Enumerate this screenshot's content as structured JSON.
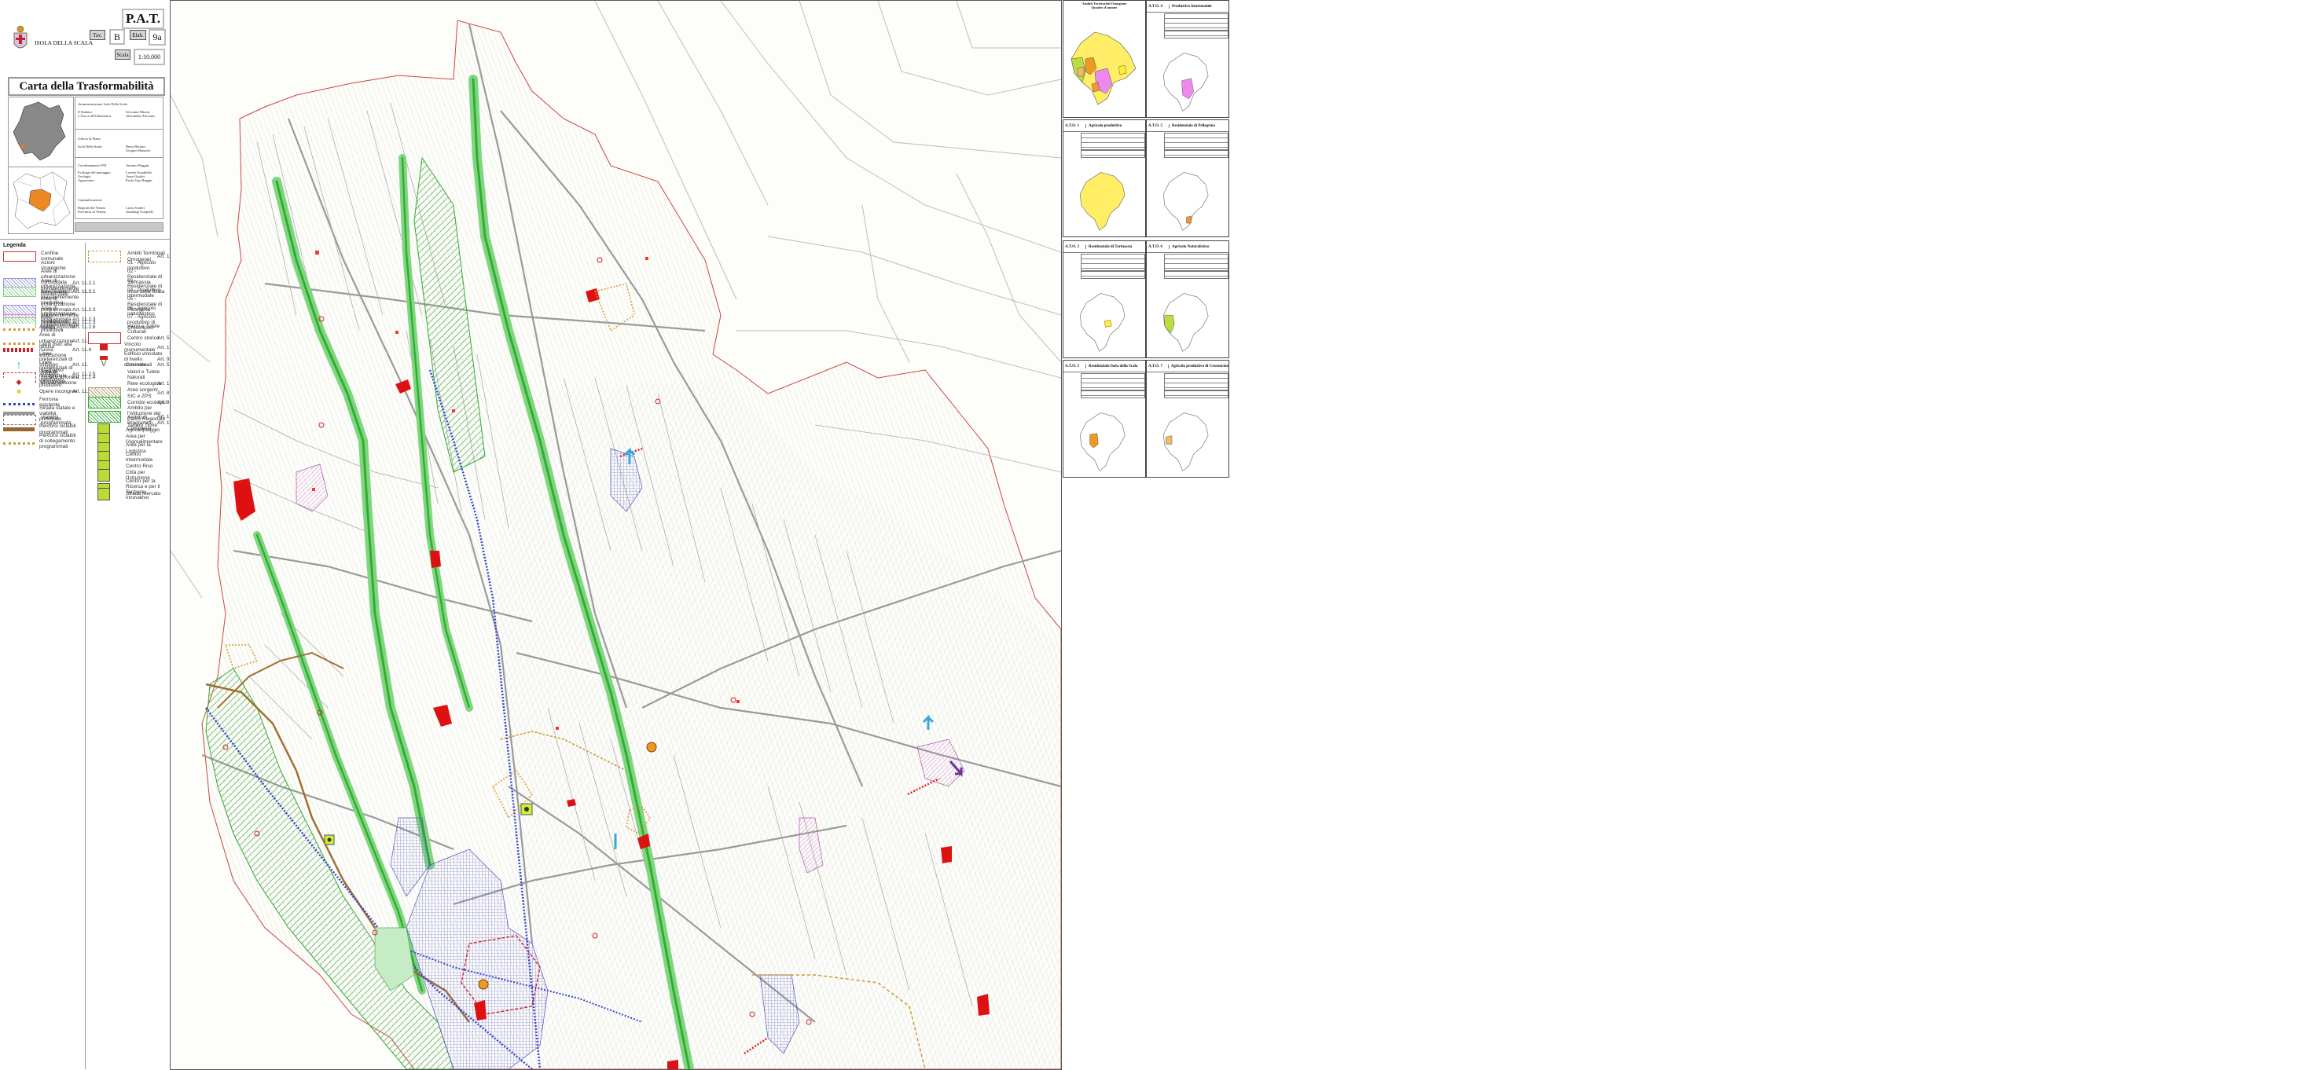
{
  "header": {
    "plan_code": "P.A.T.",
    "municipality": "ISOLA DELLA SCALA",
    "tav_label": "Tav.",
    "tav_value": "B",
    "elab_label": "Elab.",
    "elab_value": "9a",
    "scala_label": "Scala",
    "scala_value": "1:10.000",
    "title": "Carta della Trasformabilità"
  },
  "credits": [
    {
      "role": "Amministrazione Isola Della Scala",
      "names": ""
    },
    {
      "role": "Il Sindaco\nL'Ass.re all'Urbanistica",
      "names": "Giovanni Miozzi\nAlessandro Facciani"
    },
    {
      "role": "Ufficio di Piano",
      "names": ""
    },
    {
      "role": "Isola Della Scala",
      "names": "Berto Bertaso\nGiorgio Monachi"
    },
    {
      "role": "Coordinamento PAT",
      "names": "Antonio Buggin"
    },
    {
      "role": "Ecologia del paesaggio\nGeologia\nAgronomia",
      "names": "Loredo Scarabello\nAnna Giudici\nPaolo Ugo Buggin"
    },
    {
      "role": "Copianificazione",
      "names": ""
    },
    {
      "role": "Regione del Veneto\nProvincia di Verona",
      "names": "Lucia Scaleri\nGianluigi Scarpelly"
    }
  ],
  "legend": {
    "title": "Legenda",
    "left": [
      {
        "label": "Confine comunale",
        "art": "",
        "color": "#cc3333",
        "style": "outline"
      },
      {
        "label": "Azioni strategiche",
        "art": "",
        "color": "",
        "style": "none"
      },
      {
        "label": "Aree di urbanizzazione consolidata prevalentemente residenziale",
        "art": "Art. 11.2.1",
        "color": "#9999dd",
        "style": "hatch"
      },
      {
        "label": "Aree di urbanizzazione consolidata prevalentemente produttiva",
        "art": "Art. 11.2.1",
        "color": "#cc88cc",
        "style": "hatch"
      },
      {
        "label": "Aree a servizi",
        "art": "Art. 11.2.1",
        "color": "#88cc88",
        "style": "hatch"
      },
      {
        "label": "Aree di urbanizzazione programmata prevalentemente residenziale",
        "art": "Art. 11.2.3",
        "color": "#9999dd",
        "style": "hatch"
      },
      {
        "label": "Aree di urbanizzazione programmata prevalentemente produttiva",
        "art": "Art. 11.2.3",
        "color": "#cc88cc",
        "style": "hatch"
      },
      {
        "label": "Aree programmate a servizi",
        "art": "Art. 11.2.3",
        "color": "#88cc88",
        "style": "hatch"
      },
      {
        "label": "Ambito Agricolo",
        "art": "Art. 11.2.6",
        "color": "#dd9933",
        "style": "dotted"
      },
      {
        "label": "Aree di urbanizzazione diffusa",
        "art": "Art. 11.2.2",
        "color": "#dd9933",
        "style": "dotted"
      },
      {
        "label": "Limiti fisici alla nuova edificazione",
        "art": "Art. 11.4",
        "color": "#cc2222",
        "style": "teeth"
      },
      {
        "label": "Linee preferenziali di sviluppo insediativo residenziale",
        "art": "Art. 11.2.5",
        "color": "#33aadd",
        "style": "arrow"
      },
      {
        "label": "Linee preferenziali di sviluppo insediativo produttivo",
        "art": "Art. 11.2.5",
        "color": "#663399",
        "style": "arrow"
      },
      {
        "label": "Aree di riqualificazione e di riconversione",
        "art": "Art. 11.2.4",
        "color": "#cc3333",
        "style": "dashed"
      },
      {
        "label": "Allevamenti",
        "art": "",
        "color": "#cc2222",
        "style": "dot"
      },
      {
        "label": "Opere incongrue",
        "art": "Art. 11.5",
        "color": "#ddcc33",
        "style": "square"
      },
      {
        "label": "Ferrovia esistente",
        "art": "",
        "color": "#3344cc",
        "style": "dotted"
      },
      {
        "label": "Strada statale e viabilità principale",
        "art": "",
        "color": "#999999",
        "style": "solid"
      },
      {
        "label": "Viabilità programmata",
        "art": "",
        "color": "#777777",
        "style": "dashed"
      },
      {
        "label": "Percorsi ciclabili programmati",
        "art": "",
        "color": "#996633",
        "style": "solid"
      },
      {
        "label": "Percorsi ciclabili di collegamento programmati",
        "art": "",
        "color": "#cc9933",
        "style": "dotted"
      }
    ],
    "right": [
      {
        "label": "Ambiti Territoriali Omogenei",
        "art": "Art. 11.1",
        "color": "#cc9933",
        "style": "dashed"
      },
      {
        "label": "01 - Agricolo produttivo",
        "art": "",
        "color": "",
        "style": "none"
      },
      {
        "label": "02 - Residenziale di Tarmassia",
        "art": "",
        "color": "",
        "style": "none"
      },
      {
        "label": "03 - Residenziale di Isola della Scala",
        "art": "",
        "color": "",
        "style": "none"
      },
      {
        "label": "04 - Produttivo intermodale",
        "art": "",
        "color": "",
        "style": "none"
      },
      {
        "label": "05 - Residenziale di Pellegrina",
        "art": "",
        "color": "",
        "style": "none"
      },
      {
        "label": "06 - Agricolo naturalistico",
        "art": "",
        "color": "",
        "style": "none"
      },
      {
        "label": "07 - Agricolo produttivo di Crosoncino",
        "art": "",
        "color": "",
        "style": "none"
      },
      {
        "label": "Valori e Tutele Culturali",
        "art": "",
        "color": "",
        "style": "none"
      },
      {
        "label": "Centro storico",
        "art": "Art. 5.5.1",
        "color": "#cc3333",
        "style": "outline"
      },
      {
        "label": "Vincolo monumentale",
        "art": "Art. 17.1.1",
        "color": "#cc2222",
        "style": "fill"
      },
      {
        "label": "Edificio vincolato di livello comunale",
        "art": "Art. 9.4",
        "color": "#cc2222",
        "style": "fill"
      },
      {
        "label": "Coni visuali",
        "art": "Art. 5.6.12",
        "color": "#666633",
        "style": "cone"
      },
      {
        "label": "Valori e Tutele Naturali",
        "art": "",
        "color": "",
        "style": "none"
      },
      {
        "label": "Rete ecologica",
        "art": "Art. 17.2.2",
        "color": "",
        "style": "none"
      },
      {
        "label": "Aree sorgenti SIC e ZPS",
        "art": "Art. 8.1.7",
        "color": "#aa9966",
        "style": "hatch"
      },
      {
        "label": "Corridoi ecologici",
        "art": "Art. 8.1.1",
        "color": "#33aa33",
        "style": "hatch"
      },
      {
        "label": "Ambito per l'istituzione del Parco Regionale Tartaro Tione",
        "art": "Art. 17.2.1",
        "color": "#33aa33",
        "style": "hatch"
      },
      {
        "label": "Ambiti di Programmi Complessi",
        "art": "Art. 11.2.9",
        "color": "",
        "style": "none"
      },
      {
        "label": "Agriconpiaggio",
        "art": "",
        "color": "#bbdd33",
        "style": "icon"
      },
      {
        "label": "Area per l'Agroalimentare",
        "art": "",
        "color": "#bbdd33",
        "style": "icon"
      },
      {
        "label": "Area per la Logistica",
        "art": "",
        "color": "#bbdd33",
        "style": "icon"
      },
      {
        "label": "Centro Intermodale",
        "art": "",
        "color": "#bbdd33",
        "style": "icon"
      },
      {
        "label": "Centro Riso",
        "art": "",
        "color": "#bbdd33",
        "style": "icon"
      },
      {
        "label": "Città per l'Istruzione",
        "art": "",
        "color": "#bbdd33",
        "style": "icon"
      },
      {
        "label": "Centro per la Ricerca e per il Terziario innovativo",
        "art": "",
        "color": "#bbdd33",
        "style": "icon"
      },
      {
        "label": "Strada Mercato",
        "art": "",
        "color": "#bbdd33",
        "style": "icon"
      }
    ]
  },
  "ato_panels": [
    {
      "num": "",
      "name": "Ambiti Territoriali Omogenei\nQuadro d'unione",
      "fill": "#ffee66"
    },
    {
      "num": "A.T.O. 4",
      "name": "Produttivo Intermodale",
      "fill": "#ee88ee"
    },
    {
      "num": "A.T.O. 1",
      "name": "Agricolo produttivo",
      "fill": "#ffee66"
    },
    {
      "num": "A.T.O. 5",
      "name": "Residenziale di Pellegrina",
      "fill": "#ee9933"
    },
    {
      "num": "A.T.O. 2",
      "name": "Residenziale di Tarmassia",
      "fill": "#ffee33"
    },
    {
      "num": "A.T.O. 6",
      "name": "Agricolo Naturalistico",
      "fill": "#bbdd44"
    },
    {
      "num": "A.T.O. 3",
      "name": "Residenziale Isola della Scala",
      "fill": "#ee9922"
    },
    {
      "num": "A.T.O. 7",
      "name": "Agricolo produttivo di Crosoncino",
      "fill": "#eebb66"
    }
  ],
  "colors": {
    "frame": "#444444",
    "green_corridor": "#33aa33",
    "railway": "#3344cc",
    "boundary": "#cc3333",
    "red_fill": "#dd1111",
    "urban": "#8888cc"
  }
}
